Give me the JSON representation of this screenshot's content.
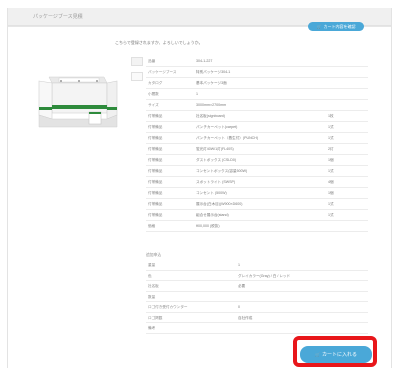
{
  "header": {
    "title": "パッケージブース見積"
  },
  "top_button": {
    "label": "カート内容を確認"
  },
  "question": "こちらで登録されますか、よろしいでしょうか。",
  "product_rows": [
    {
      "key": "品番",
      "value": "304-1-227",
      "qty": ""
    },
    {
      "key": "パッケージブース",
      "value": "特別パッケージ304-1",
      "qty": ""
    },
    {
      "key": "カタログ",
      "value": "基本パッケージ3面",
      "qty": ""
    },
    {
      "key": "小間数",
      "value": "1",
      "qty": ""
    },
    {
      "key": "サイズ",
      "value": "3000mm×2700mm",
      "qty": ""
    },
    {
      "key": "付帯備品",
      "value": "社名板(signboard)",
      "qty": "1枚"
    },
    {
      "key": "付帯備品",
      "value": "パンチカーペット(carpet)",
      "qty": "1式"
    },
    {
      "key": "付帯備品",
      "value": "パンチカーペット（養生付）(PUNCH)",
      "qty": "1式"
    },
    {
      "key": "付帯備品",
      "value": "蛍光灯40W/1灯(FL40S)",
      "qty": "2灯"
    },
    {
      "key": "付帯備品",
      "value": "ダストボックス (CSLD0)",
      "qty": "1個"
    },
    {
      "key": "付帯備品",
      "value": "コンセントボックス(容量500W)",
      "qty": "1式"
    },
    {
      "key": "付帯備品",
      "value": "スポットライト (SWSP)",
      "qty": "4個"
    },
    {
      "key": "付帯備品",
      "value": "コンセント (500W)",
      "qty": "1個"
    },
    {
      "key": "付帯備品",
      "value": "展示台(白木目)(W900×D600)",
      "qty": "1式"
    },
    {
      "key": "付帯備品",
      "value": "組合せ展示台(stand)",
      "qty": "1式"
    },
    {
      "key": "価格",
      "value": "¥00,000 (税抜)",
      "qty": ""
    }
  ],
  "options_heading": "追加申込",
  "option_rows": [
    {
      "key": "重量",
      "value": "1"
    },
    {
      "key": "色",
      "value": "グレイカラー(Gray) / 白 / レッド"
    },
    {
      "key": "社名板",
      "value": "必要"
    },
    {
      "key": "数量",
      "value": ""
    },
    {
      "key": "ロゴ付き受付カウンター",
      "value": "0"
    },
    {
      "key": "ロゴ掲載",
      "value": "自社作成"
    },
    {
      "key": "備考",
      "value": ""
    }
  ],
  "bottom_button": {
    "label": "カートに入れる"
  },
  "colors": {
    "accent": "#4aa8d8",
    "highlight": "#e8161a"
  }
}
